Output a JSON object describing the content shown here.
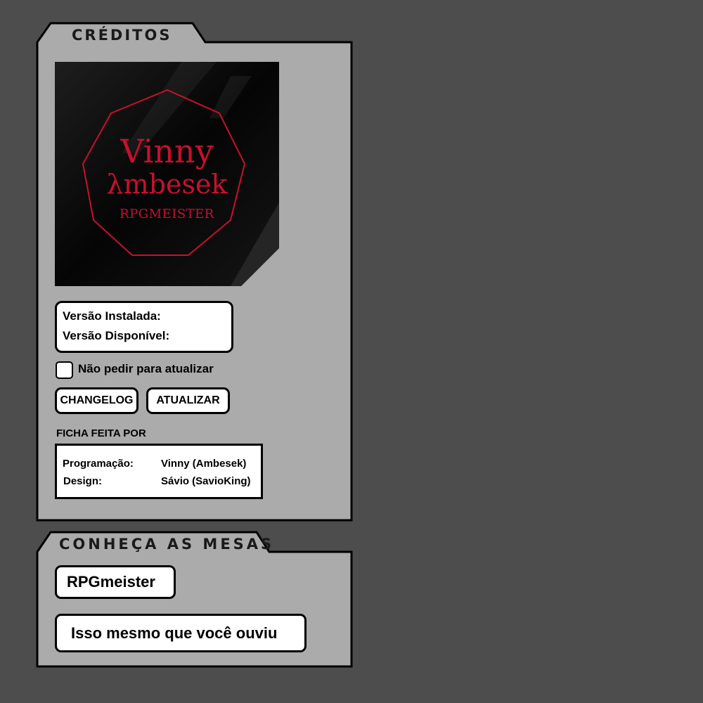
{
  "colors": {
    "background": "#4d4d4d",
    "panel": "#aaabaa",
    "logo_bg": "#000000",
    "logo_accent": "#c8102e"
  },
  "credits_panel": {
    "title": "CRÉDITOS",
    "logo": {
      "line1": "Vinny",
      "line2": "λmbesek",
      "line3": "RPGMEISTER"
    },
    "version": {
      "installed_label": "Versão Instalada:",
      "available_label": "Versão Disponível:"
    },
    "dont_ask_update": {
      "label": "Não pedir para atualizar",
      "checked": false
    },
    "buttons": {
      "changelog": "CHANGELOG",
      "update": "ATUALIZAR"
    },
    "made_by_label": "FICHA FEITA POR",
    "credits": [
      {
        "role": "Programação:",
        "name": "Vinny (Ambesek)"
      },
      {
        "role": "Design:",
        "name": "Sávio (SavioKing)"
      }
    ]
  },
  "mesas_panel": {
    "title": "CONHEÇA AS MESAS",
    "links": [
      "RPGmeister",
      "Isso mesmo que você ouviu"
    ]
  }
}
